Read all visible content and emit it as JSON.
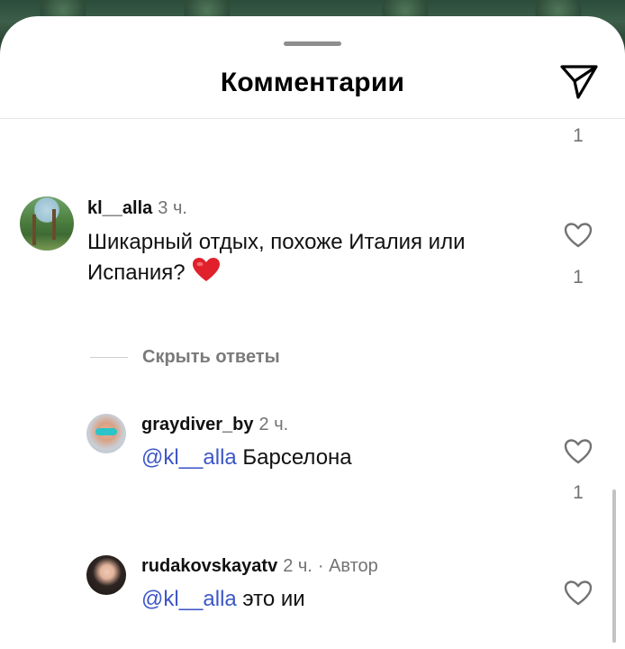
{
  "header": {
    "title": "Комментарии"
  },
  "top_count": "1",
  "comments": [
    {
      "username": "kl__alla",
      "time": "3 ч.",
      "text": "Шикарный отдых, похоже Италия или Испания?",
      "like_count": "1"
    }
  ],
  "hide_replies": "Скрыть ответы",
  "replies": [
    {
      "username": "graydiver_by",
      "time": "2 ч.",
      "mention": "@kl__alla",
      "text": "Барселона",
      "like_count": "1"
    },
    {
      "username": "rudakovskayatv",
      "time": "2 ч.",
      "tag": "· Автор",
      "mention": "@kl__alla",
      "text": "это ии"
    }
  ],
  "colors": {
    "mention": "#3d57c7",
    "muted": "#737373",
    "emoji_heart": "#e0202a"
  }
}
